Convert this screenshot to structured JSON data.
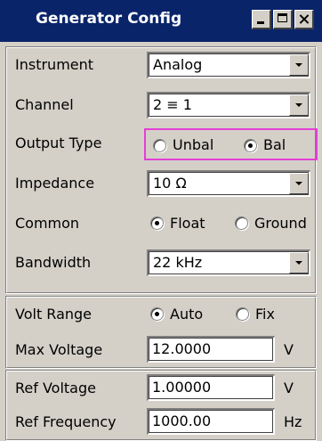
{
  "window": {
    "title": "Generator Config",
    "controls": [
      "minimize-icon",
      "maximize-icon",
      "close-icon"
    ]
  },
  "colors": {
    "titlebar": "#0a246a",
    "panel": "#d4d0c8",
    "highlight": "#e43fd6"
  },
  "instrument": {
    "label": "Instrument",
    "value": "Analog"
  },
  "channel": {
    "label": "Channel",
    "value": "2 ≡ 1"
  },
  "output_type": {
    "label": "Output Type",
    "options": [
      "Unbal",
      "Bal"
    ],
    "selected": "Bal"
  },
  "impedance": {
    "label": "Impedance",
    "value": "10 Ω"
  },
  "common": {
    "label": "Common",
    "options": [
      "Float",
      "Ground"
    ],
    "selected": "Float"
  },
  "bandwidth": {
    "label": "Bandwidth",
    "value": "22 kHz"
  },
  "volt_range": {
    "label": "Volt Range",
    "options": [
      "Auto",
      "Fix"
    ],
    "selected": "Auto"
  },
  "max_voltage": {
    "label": "Max Voltage",
    "value": "12.0000",
    "unit": "V"
  },
  "ref_voltage": {
    "label": "Ref Voltage",
    "value": "1.00000",
    "unit": "V"
  },
  "ref_frequency": {
    "label": "Ref Frequency",
    "value": "1000.00",
    "unit": "Hz"
  }
}
